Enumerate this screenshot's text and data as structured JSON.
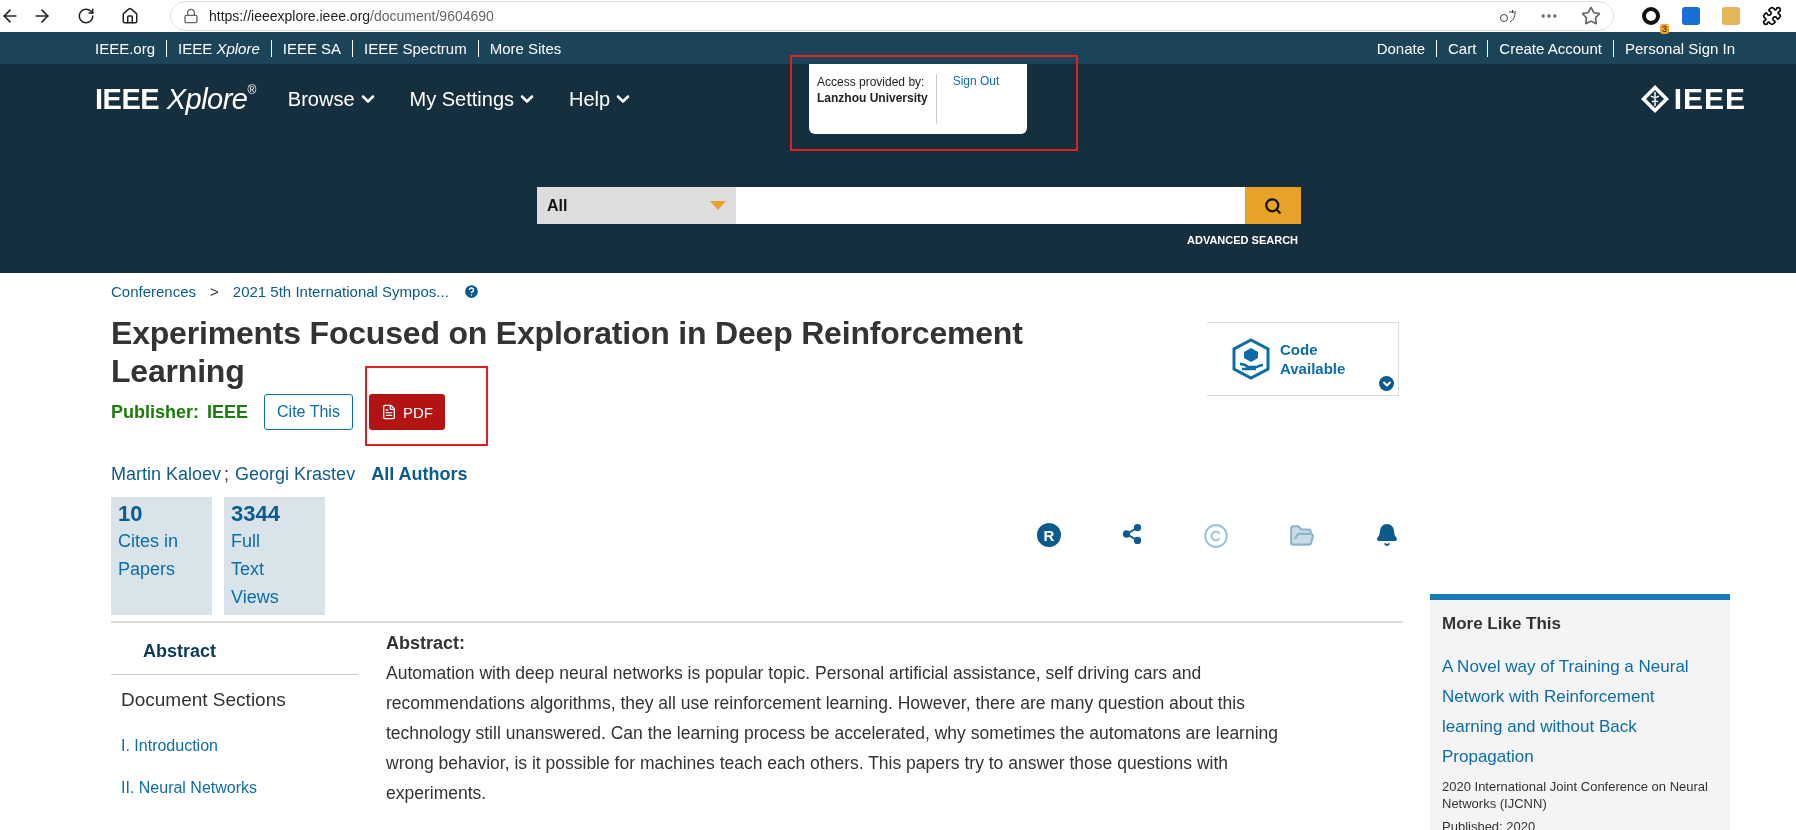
{
  "browser": {
    "url_host": "https://ieeexplore.ieee.org",
    "url_path": "/document/9604690",
    "extension_badge": "3"
  },
  "top_links_left": [
    "IEEE.org",
    "IEEE *Xplore*",
    "IEEE SA",
    "IEEE Spectrum",
    "More Sites"
  ],
  "top_links_right": [
    "Donate",
    "Cart",
    "Create Account",
    "Personal Sign In"
  ],
  "header": {
    "logo": "IEEE",
    "logo_italic": "Xplore",
    "logo_mark": "®",
    "menus": [
      "Browse",
      "My Settings",
      "Help"
    ],
    "access_label": "Access provided by:",
    "institution": "Lanzhou University",
    "sign_out": "Sign Out",
    "brand": "IEEE"
  },
  "search": {
    "scope": "All",
    "advanced": "ADVANCED SEARCH"
  },
  "breadcrumb": {
    "first": "Conferences",
    "separator": ">",
    "second": "2021 5th International Sympos..."
  },
  "title": "Experiments Focused on Exploration in Deep Reinforcement Learning",
  "publisher_label": "Publisher:",
  "publisher": "IEEE",
  "cite_button": "Cite This",
  "pdf_button": "PDF",
  "code_badge": {
    "line_1": "Code",
    "line_2": "Available"
  },
  "authors": [
    "Martin Kaloev",
    "Georgi Krastev"
  ],
  "author_separator": ";",
  "all_authors": "All Authors",
  "metrics": [
    {
      "value": "10",
      "label": "Cites in Papers"
    },
    {
      "value": "3344",
      "label": "Full Text Views"
    }
  ],
  "rights_glyph": "R",
  "nav": [
    {
      "label": "Abstract",
      "kind": "tab",
      "selected": true
    },
    {
      "label": "Document Sections",
      "kind": "heading",
      "selected": false
    },
    {
      "number": "I.",
      "label": "Introduction",
      "kind": "section",
      "selected": false
    },
    {
      "number": "II.",
      "label": "Neural Networks",
      "kind": "section",
      "selected": false
    }
  ],
  "abstract": {
    "heading": "Abstract:",
    "text": "Automation with deep neural networks is popular topic. Personal artificial assistance, self driving cars and recommendations algorithms, they all use reinforcement learning. However, there are many question about this technology still unanswered. Can the learning process be accelerated, why sometimes the automatons are learning wrong behavior, is it possible for machines teach each others. This papers try to answer those questions with experiments."
  },
  "more_like_this": {
    "heading": "More Like This",
    "items": [
      {
        "title": "A Novel way of Training a Neural Network with Reinforcement learning and without Back Propagation",
        "venue": "2020 International Joint Conference on Neural Networks (IJCNN)",
        "published": "Published: 2020"
      }
    ]
  }
}
